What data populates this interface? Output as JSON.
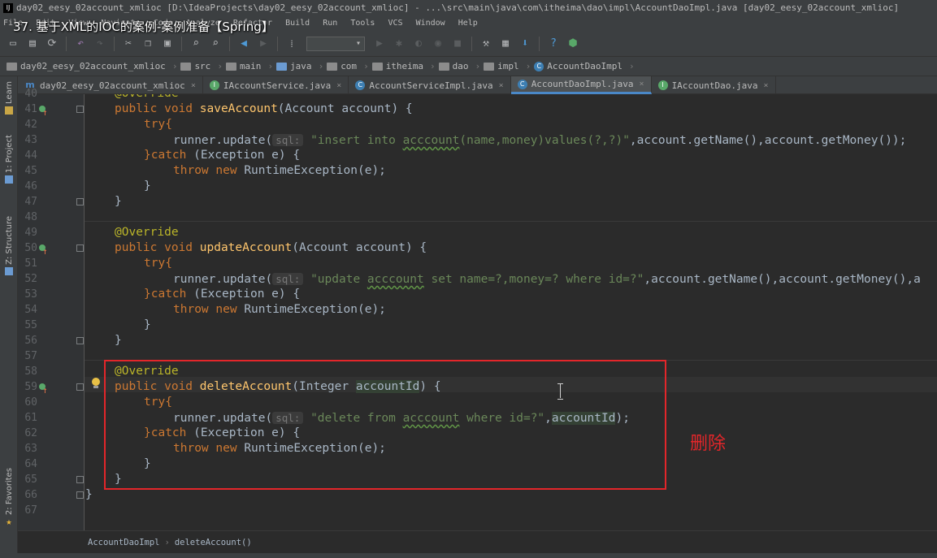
{
  "window": {
    "title": "day02_eesy_02account_xmlioc [D:\\IdeaProjects\\day02_eesy_02account_xmlioc] - ...\\src\\main\\java\\com\\itheima\\dao\\impl\\AccountDaoImpl.java [day02_eesy_02account_xmlioc]"
  },
  "video_title": "37. 基于XML的IOC的案例-案例准备【Spring】",
  "menu": [
    "File",
    "Edit",
    "View",
    "Navigate",
    "Code",
    "Analyze",
    "Refactor",
    "Build",
    "Run",
    "Tools",
    "VCS",
    "Window",
    "Help"
  ],
  "breadcrumbs": [
    "day02_eesy_02account_xmlioc",
    "src",
    "main",
    "java",
    "com",
    "itheima",
    "dao",
    "impl",
    "AccountDaoImpl"
  ],
  "tabs": [
    {
      "label": "day02_eesy_02account_xmlioc",
      "icon": "m"
    },
    {
      "label": "IAccountService.java",
      "icon": "i"
    },
    {
      "label": "AccountServiceImpl.java",
      "icon": "c"
    },
    {
      "label": "AccountDaoImpl.java",
      "icon": "c",
      "active": true
    },
    {
      "label": "IAccountDao.java",
      "icon": "i"
    }
  ],
  "sidebar": {
    "learn": "Learn",
    "project": "1: Project",
    "structure": "Z: Structure",
    "favorites": "2: Favorites"
  },
  "line_numbers": [
    "40",
    "41",
    "42",
    "43",
    "44",
    "45",
    "46",
    "47",
    "48",
    "49",
    "50",
    "51",
    "52",
    "53",
    "54",
    "55",
    "56",
    "57",
    "58",
    "59",
    "60",
    "61",
    "62",
    "63",
    "64",
    "65",
    "66",
    "67"
  ],
  "code": {
    "l40": "@Override",
    "l41_a": "public void ",
    "l41_fn": "saveAccount",
    "l41_b": "(Account account) {",
    "try": "try{",
    "runner": "runner.update(",
    "sql_hint": "sql:",
    "l43_str_a": "\"insert into ",
    "l43_typo": "acccount",
    "l43_str_b": "(name,money)values(?,?)\"",
    "l43_rest": ",account.getName(),account.getMoney());",
    "catch_a": "}catch",
    "catch_b": " (Exception e) {",
    "throw_kw": "throw new ",
    "throw_rest": "RuntimeException(e);",
    "close_inner": "}",
    "close_outer": "}",
    "l49": "@Override",
    "l50_a": "public void ",
    "l50_fn": "updateAccount",
    "l50_b": "(Account account) {",
    "l52_str_a": "\"update ",
    "l52_typo": "acccount",
    "l52_str_b": " set name=?,money=? where id=?\"",
    "l52_rest": ",account.getName(),account.getMoney(),a",
    "l58": "@Override",
    "l59_a": "public void ",
    "l59_fn": "deleteAccount",
    "l59_b": "(Integer ",
    "l59_param": "accountId",
    "l59_c": ") {",
    "l61_str_a": "\"delete from ",
    "l61_typo": "acccount",
    "l61_str_b": " where id=?\"",
    "l61_comma": ",",
    "l61_param": "accountId",
    "l61_end": ");",
    "class_close": "}"
  },
  "annotation_label": "删除",
  "status": {
    "class": "AccountDaoImpl",
    "method": "deleteAccount()"
  },
  "colors": {
    "highlight_box": "#e3262a",
    "keyword": "#cc7832",
    "annotation": "#bbb529",
    "function": "#ffc66d",
    "string": "#6a8759"
  }
}
